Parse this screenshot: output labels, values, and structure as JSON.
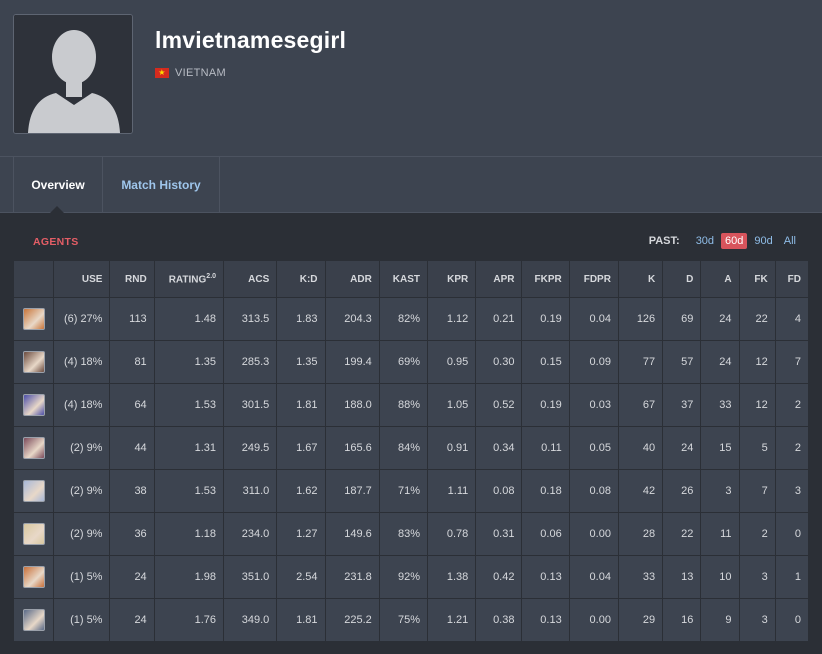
{
  "profile": {
    "name": "lmvietnamesegirl",
    "country": "VIETNAM",
    "avatar_icon": "user-silhouette-icon"
  },
  "tabs": [
    {
      "label": "Overview",
      "active": true
    },
    {
      "label": "Match History",
      "active": false
    }
  ],
  "agents_section": {
    "title": "AGENTS",
    "past_label": "PAST:",
    "past_options": [
      "30d",
      "60d",
      "90d",
      "All"
    ],
    "past_selected": "60d"
  },
  "table": {
    "headers": [
      "",
      "USE",
      "RND",
      "RATING",
      "ACS",
      "K:D",
      "ADR",
      "KAST",
      "KPR",
      "APR",
      "FKPR",
      "FDPR",
      "K",
      "D",
      "A",
      "FK",
      "FD"
    ],
    "rating_sup": "2.0",
    "rows": [
      {
        "agent_icon": "agent-portrait-1",
        "color": "#c9763a",
        "cells": [
          "(6) 27%",
          "113",
          "1.48",
          "313.5",
          "1.83",
          "204.3",
          "82%",
          "1.12",
          "0.21",
          "0.19",
          "0.04",
          "126",
          "69",
          "24",
          "22",
          "4"
        ]
      },
      {
        "agent_icon": "agent-portrait-2",
        "color": "#6a4a3e",
        "cells": [
          "(4) 18%",
          "81",
          "1.35",
          "285.3",
          "1.35",
          "199.4",
          "69%",
          "0.95",
          "0.30",
          "0.15",
          "0.09",
          "77",
          "57",
          "24",
          "12",
          "7"
        ]
      },
      {
        "agent_icon": "agent-portrait-3",
        "color": "#4c4fa8",
        "cells": [
          "(4) 18%",
          "64",
          "1.53",
          "301.5",
          "1.81",
          "188.0",
          "88%",
          "1.05",
          "0.52",
          "0.19",
          "0.03",
          "67",
          "37",
          "33",
          "12",
          "2"
        ]
      },
      {
        "agent_icon": "agent-portrait-4",
        "color": "#7a4a5a",
        "cells": [
          "(2) 9%",
          "44",
          "1.31",
          "249.5",
          "1.67",
          "165.6",
          "84%",
          "0.91",
          "0.34",
          "0.11",
          "0.05",
          "40",
          "24",
          "15",
          "5",
          "2"
        ]
      },
      {
        "agent_icon": "agent-portrait-5",
        "color": "#a8b8d8",
        "cells": [
          "(2) 9%",
          "38",
          "1.53",
          "311.0",
          "1.62",
          "187.7",
          "71%",
          "1.11",
          "0.08",
          "0.18",
          "0.08",
          "42",
          "26",
          "3",
          "7",
          "3"
        ]
      },
      {
        "agent_icon": "agent-portrait-6",
        "color": "#d8c8a0",
        "cells": [
          "(2) 9%",
          "36",
          "1.18",
          "234.0",
          "1.27",
          "149.6",
          "83%",
          "0.78",
          "0.31",
          "0.06",
          "0.00",
          "28",
          "22",
          "11",
          "2",
          "0"
        ]
      },
      {
        "agent_icon": "agent-portrait-7",
        "color": "#c8703a",
        "cells": [
          "(1) 5%",
          "24",
          "1.98",
          "351.0",
          "2.54",
          "231.8",
          "92%",
          "1.38",
          "0.42",
          "0.13",
          "0.04",
          "33",
          "13",
          "10",
          "3",
          "1"
        ]
      },
      {
        "agent_icon": "agent-portrait-8",
        "color": "#5a6a88",
        "cells": [
          "(1) 5%",
          "24",
          "1.76",
          "349.0",
          "1.81",
          "225.2",
          "75%",
          "1.21",
          "0.38",
          "0.13",
          "0.00",
          "29",
          "16",
          "9",
          "3",
          "0"
        ]
      }
    ]
  }
}
